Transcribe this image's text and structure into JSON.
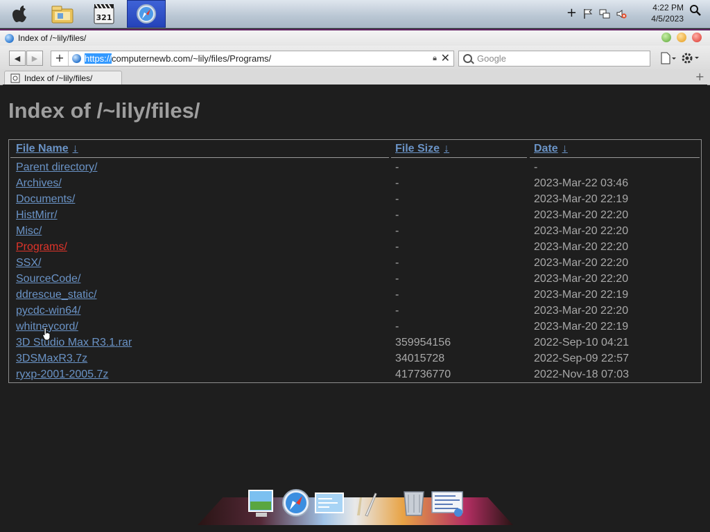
{
  "taskbar": {
    "clock_time": "4:22 PM",
    "clock_date": "4/5/2023",
    "apps": [
      "explorer-icon",
      "media-player-icon",
      "safari-icon"
    ],
    "tray": [
      "plus-icon",
      "flag-icon",
      "network-icon",
      "volume-muted-icon",
      "search-icon"
    ]
  },
  "window": {
    "title": "Index of /~lily/files/"
  },
  "toolbar": {
    "url_scheme": "https://",
    "url_rest": "computernewb.com/~lily/files/Programs/",
    "search_placeholder": "Google"
  },
  "tab": {
    "title": "Index of /~lily/files/"
  },
  "page": {
    "heading": "Index of /~lily/files/",
    "columns": {
      "name": "File Name",
      "size": "File Size",
      "date": "Date",
      "sort_arrow": "↓"
    },
    "rows": [
      {
        "name": "Parent directory/",
        "size": "-",
        "date": "-"
      },
      {
        "name": "Archives/",
        "size": "-",
        "date": "2023-Mar-22 03:46"
      },
      {
        "name": "Documents/",
        "size": "-",
        "date": "2023-Mar-20 22:19"
      },
      {
        "name": "HistMirr/",
        "size": "-",
        "date": "2023-Mar-20 22:20"
      },
      {
        "name": "Misc/",
        "size": "-",
        "date": "2023-Mar-20 22:20"
      },
      {
        "name": "Programs/",
        "size": "-",
        "date": "2023-Mar-20 22:20"
      },
      {
        "name": "SSX/",
        "size": "-",
        "date": "2023-Mar-20 22:20"
      },
      {
        "name": "SourceCode/",
        "size": "-",
        "date": "2023-Mar-20 22:20"
      },
      {
        "name": "ddrescue_static/",
        "size": "-",
        "date": "2023-Mar-20 22:19"
      },
      {
        "name": "pycdc-win64/",
        "size": "-",
        "date": "2023-Mar-20 22:20"
      },
      {
        "name": "whitneycord/",
        "size": "-",
        "date": "2023-Mar-20 22:19"
      },
      {
        "name": "3D Studio Max R3.1.rar",
        "size": "359954156",
        "date": "2022-Sep-10 04:21"
      },
      {
        "name": "3DSMaxR3.7z",
        "size": "34015728",
        "date": "2022-Sep-09 22:57"
      },
      {
        "name": "ryxp-2001-2005.7z",
        "size": "417736770",
        "date": "2022-Nov-18 07:03"
      }
    ]
  },
  "dock": {
    "items": [
      "finder-icon",
      "safari-icon",
      "preview-icon",
      "tools-icon",
      "trash-icon",
      "system-preferences-icon"
    ]
  },
  "colors": {
    "link": "#6a93c6",
    "link_hover": "#e0342a",
    "text": "#a9a9a9",
    "heading": "#9e9e9e",
    "background": "#1e1e1e"
  }
}
